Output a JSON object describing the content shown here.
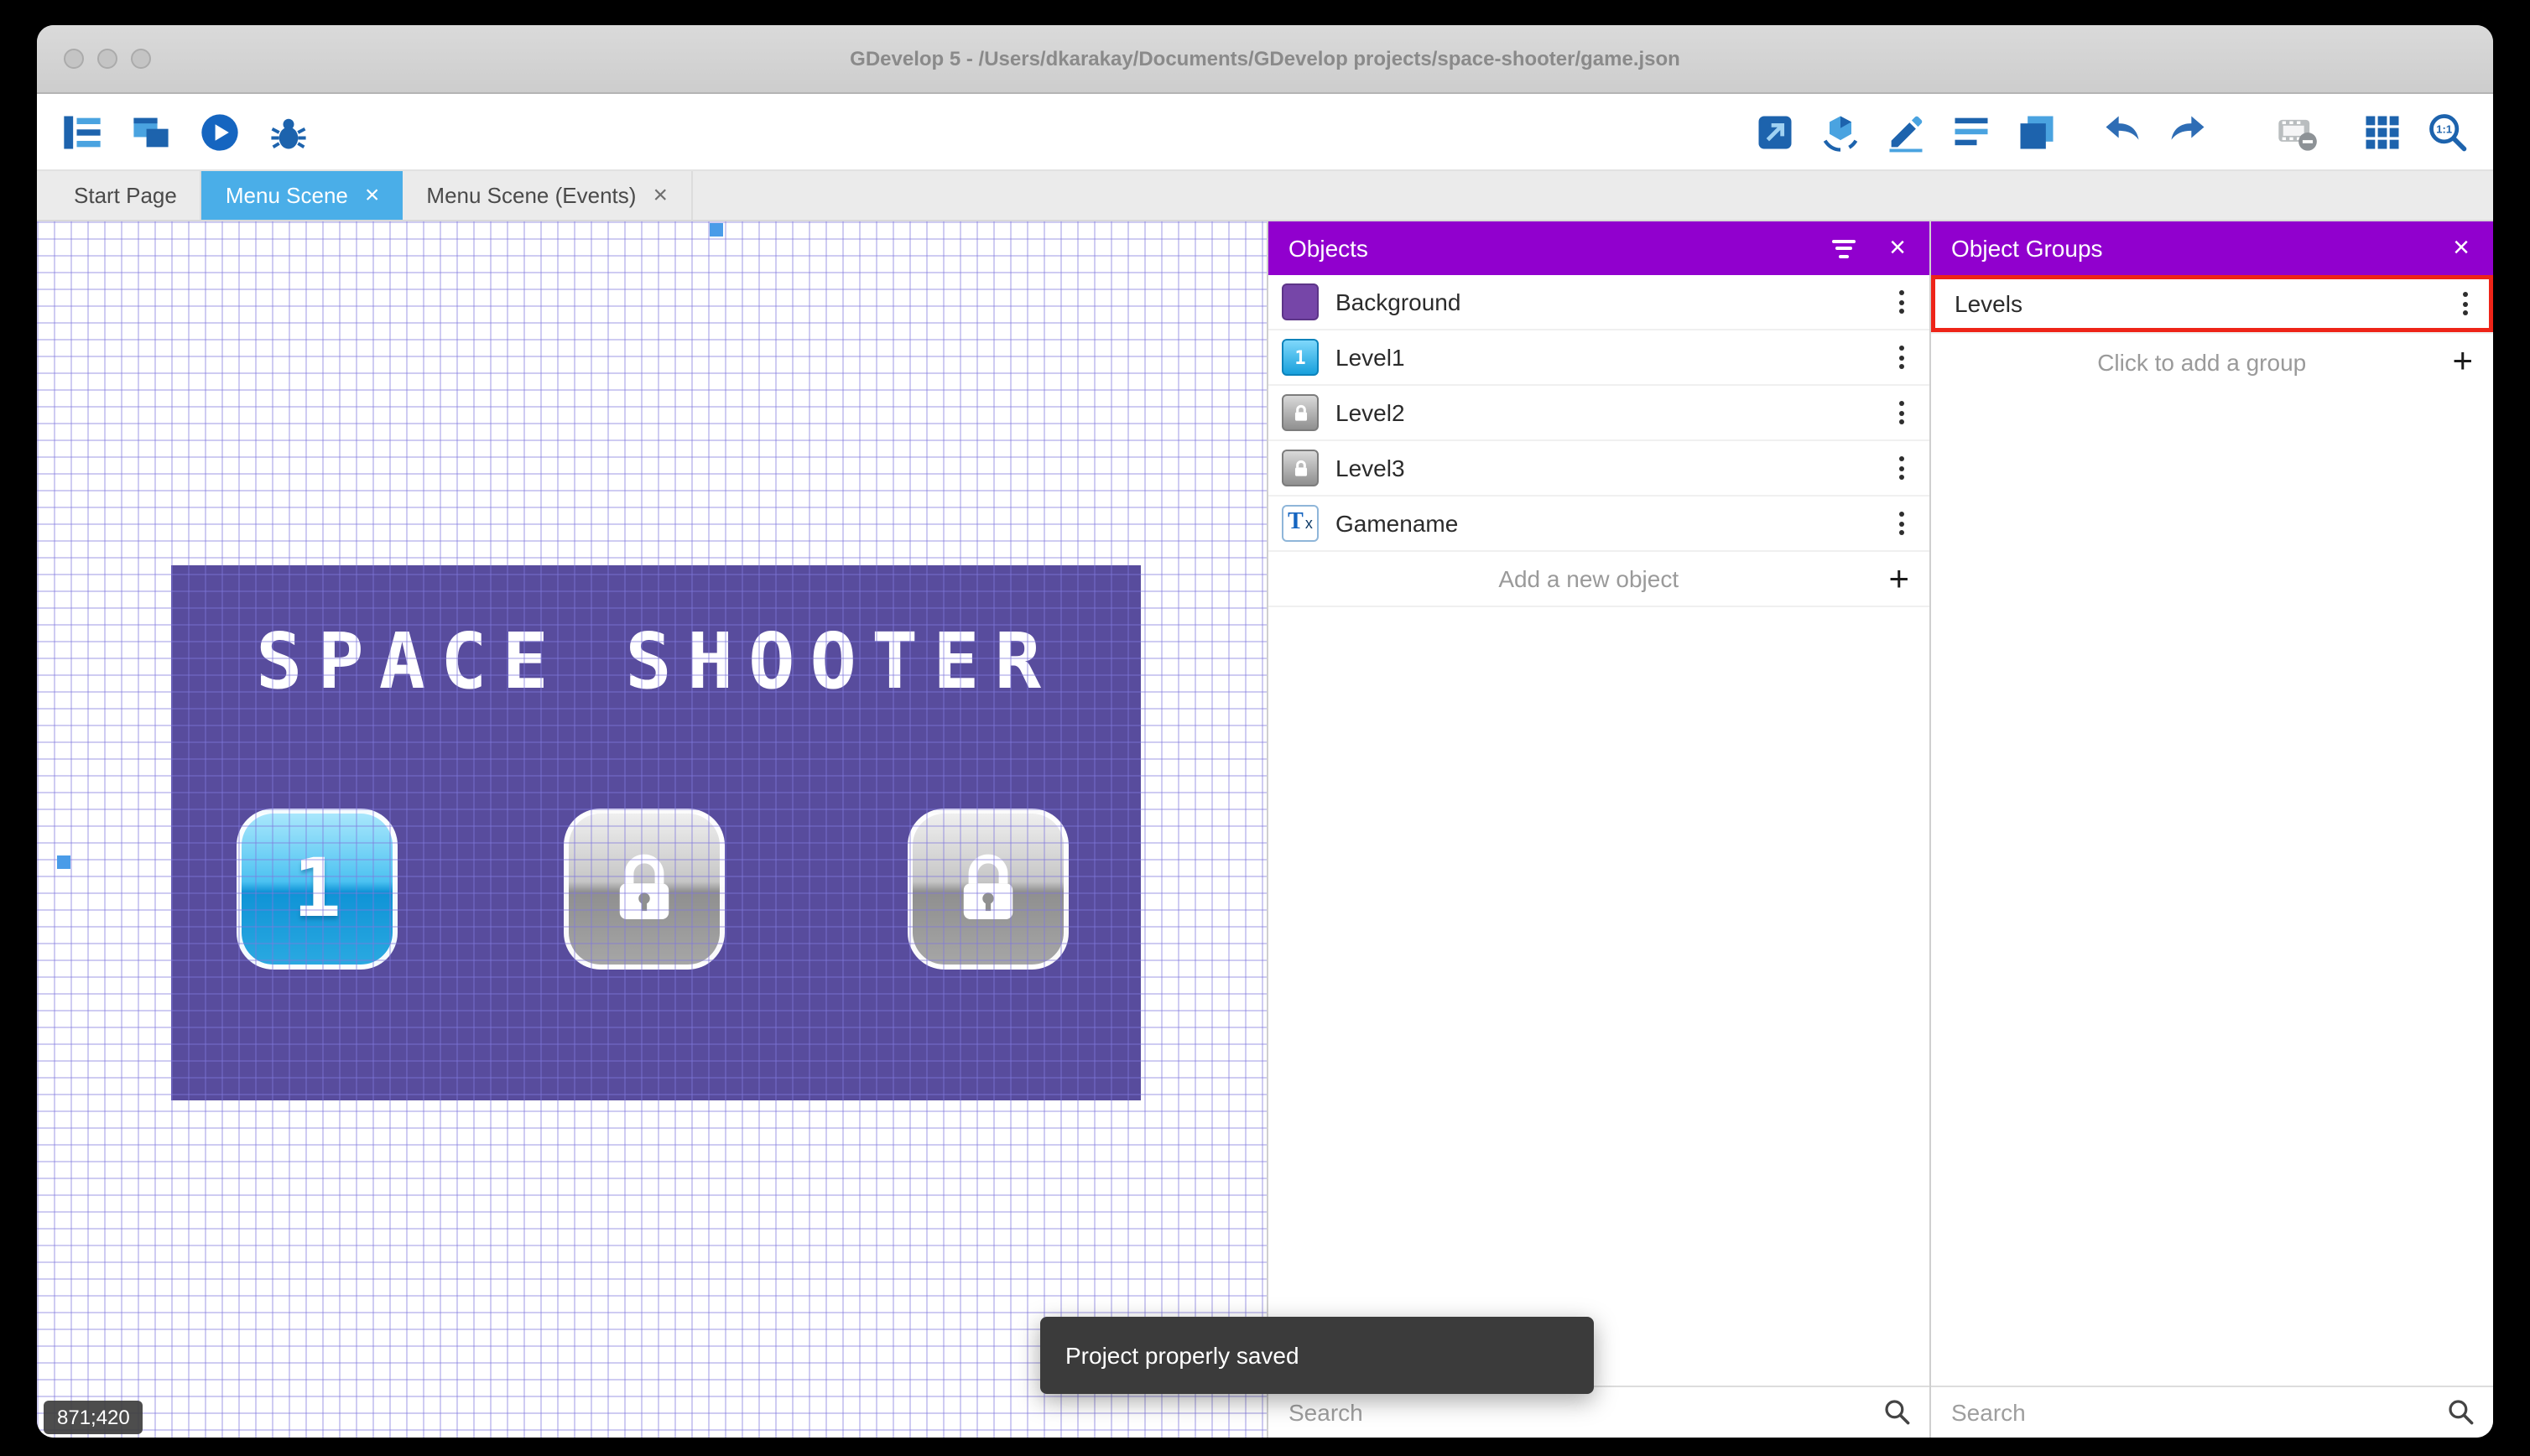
{
  "window": {
    "title": "GDevelop 5 - /Users/dkarakay/Documents/GDevelop projects/space-shooter/game.json"
  },
  "toolbar": {
    "left_icons": [
      "project-manager-icon",
      "preview-window-icon",
      "play-icon",
      "debug-icon"
    ],
    "right_icons": [
      "publish-icon",
      "extensions-icon",
      "edit-icon",
      "list-icon",
      "layers-icon",
      "undo-icon",
      "redo-icon",
      "film-minus-icon",
      "grid-icon",
      "zoom-icon"
    ],
    "zoom_label": "1:1"
  },
  "tabs": [
    {
      "label": "Start Page",
      "active": false
    },
    {
      "label": "Menu Scene",
      "active": true
    },
    {
      "label": "Menu Scene (Events)",
      "active": false
    }
  ],
  "canvas": {
    "coordinates": "871;420",
    "game_title": "SPACE SHOOTER",
    "level_button_label": "1"
  },
  "objects_panel": {
    "title": "Objects",
    "items": [
      {
        "label": "Background"
      },
      {
        "label": "Level1",
        "badge": "1"
      },
      {
        "label": "Level2"
      },
      {
        "label": "Level3"
      },
      {
        "label": "Gamename",
        "badge": "T",
        "badge_sub": "x"
      }
    ],
    "add_label": "Add a new object",
    "search_placeholder": "Search"
  },
  "groups_panel": {
    "title": "Object Groups",
    "items": [
      {
        "label": "Levels",
        "highlighted": true
      }
    ],
    "add_label": "Click to add a group",
    "search_placeholder": "Search"
  },
  "toast": {
    "message": "Project properly saved"
  },
  "colors": {
    "panel_header": "#9100CE",
    "active_tab": "#4AAEE8",
    "highlight_red": "#EE2418",
    "scene_background": "#584C9D"
  }
}
